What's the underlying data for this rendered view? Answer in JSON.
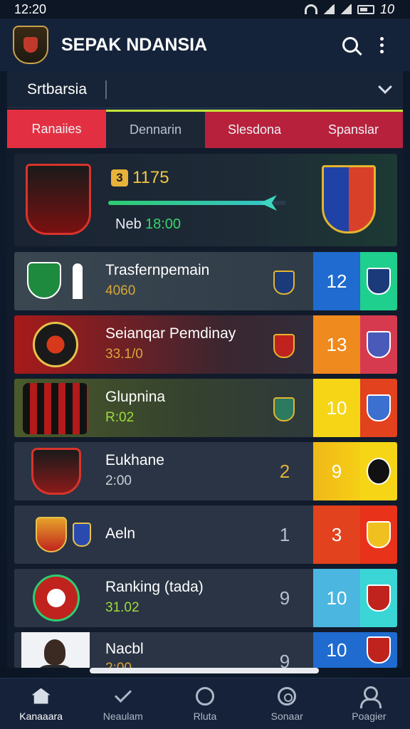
{
  "status_bar": {
    "time": "12:20",
    "battery": "10"
  },
  "header": {
    "title": "SEPAK NDANSIA"
  },
  "selector": {
    "label": "Srtbarsia"
  },
  "tabs": [
    {
      "label": "Ranaiies"
    },
    {
      "label": "Dennarin"
    },
    {
      "label": "Slesdona"
    },
    {
      "label": "Spanslar"
    }
  ],
  "match": {
    "score": "1175",
    "score_badge": "3",
    "time_label": "Neb",
    "time_value": "18:00",
    "progress": 0.9
  },
  "rows": [
    {
      "title": "Trasfernpemain",
      "subtitle": "4060",
      "rank": "",
      "score": "12"
    },
    {
      "title": "Seianqar Pemdinay",
      "subtitle": "33.1/0",
      "rank": "",
      "score": "13"
    },
    {
      "title": "Glupnina",
      "subtitle": "R:02",
      "rank": "",
      "score": "10"
    },
    {
      "title": "Eukhane",
      "subtitle": "2:00",
      "rank": "2",
      "score": "9"
    },
    {
      "title": "Aeln",
      "subtitle": "",
      "rank": "1",
      "score": "3"
    },
    {
      "title": "Ranking (tada)",
      "subtitle": "31.02",
      "rank": "9",
      "score": "10"
    },
    {
      "title": "Nacbl",
      "subtitle": "2:00",
      "rank": "9",
      "score": "10"
    }
  ],
  "bottom_nav": [
    {
      "label": "Kanaaara"
    },
    {
      "label": "Neaulam"
    },
    {
      "label": "Rluta"
    },
    {
      "label": "Sonaar"
    },
    {
      "label": "Poagier"
    }
  ],
  "colors": {
    "accent_red": "#e23042",
    "accent_lime": "#c7e33a",
    "score_blue": "#1f6bd0",
    "score_orange": "#ef8a1f",
    "score_yellow": "#f5d516",
    "score_red": "#e2421e",
    "score_cyan": "#4bb6e0"
  }
}
